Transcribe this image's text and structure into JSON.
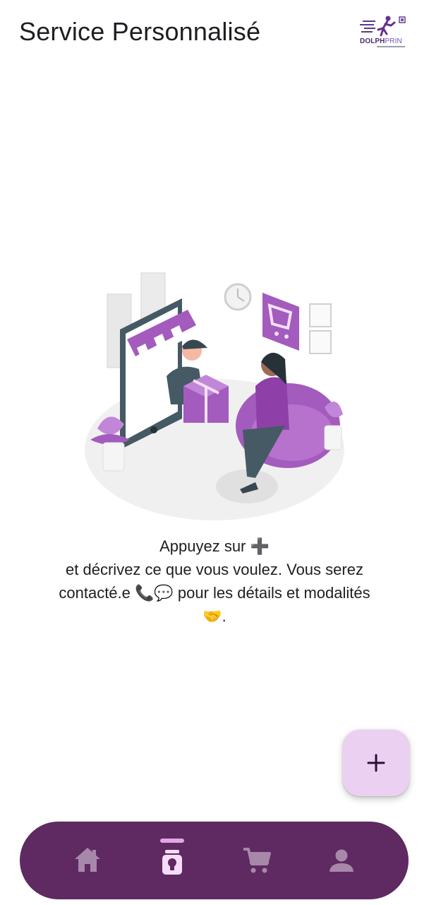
{
  "header": {
    "title": "Service Personnalisé",
    "logo": {
      "icon": "runner-logo-icon",
      "text_primary": "DOLPH",
      "text_accent": "PRIN"
    }
  },
  "hint": {
    "line1": "Appuyez sur ➕",
    "line2": "et décrivez ce que vous voulez. Vous serez",
    "line3": "contacté.e 📞💬 pour les détails et modalités",
    "line4": "🤝."
  },
  "fab": {
    "icon": "plus-icon"
  },
  "bottom_nav": {
    "items": [
      {
        "icon": "home-icon",
        "active": false
      },
      {
        "icon": "personalized-service-icon",
        "active": true
      },
      {
        "icon": "cart-icon",
        "active": false
      },
      {
        "icon": "profile-icon",
        "active": false
      }
    ]
  },
  "colors": {
    "nav_background": "#5e2a61",
    "nav_icon_inactive": "#a788aa",
    "nav_icon_active": "#f6dcf8",
    "nav_indicator": "#e2a6e8",
    "fab_background": "#ecd0f2",
    "fab_icon": "#2b0f3a",
    "illustration_accent": "#a35bbd"
  }
}
